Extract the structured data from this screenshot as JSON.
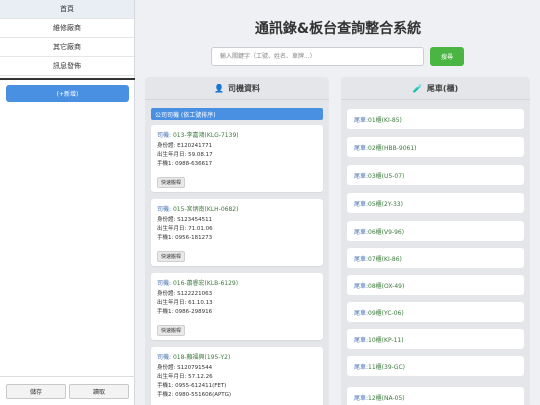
{
  "sidebar": {
    "nav": [
      "首頁",
      "維修廠商",
      "其它廠商",
      "訊息發佈"
    ],
    "add_label": "(+新增)",
    "save_label": "儲存",
    "load_label": "讀取"
  },
  "main": {
    "title": "通訊錄&板台查詢整合系統",
    "search_placeholder": "輸入關鍵字（工號、姓名、車牌...）",
    "search_button": "搜尋"
  },
  "drivers_panel": {
    "icon": "👤",
    "header": "司機資料",
    "group": "公司司機 (依工號排序)",
    "quick_label": "快速搬桿",
    "cards": [
      {
        "role": "司機: ",
        "name": "013-李嘉鴻(KLG-7139)",
        "lines": [
          "身份證: E120241771",
          "出生年月日: 59.08.17",
          "手機1: 0988-636617"
        ]
      },
      {
        "role": "司機: ",
        "name": "015-宮炳南(KLH-0682)",
        "lines": [
          "身份證: S123454511",
          "出生年月日: 71.01.06",
          "手機1: 0956-181273"
        ]
      },
      {
        "role": "司機: ",
        "name": "016-蕭睿宏(KLB-6129)",
        "lines": [
          "身份證: S122221063",
          "出生年月日: 61.10.13",
          "手機1: 0986-298916"
        ]
      },
      {
        "role": "司機: ",
        "name": "018-顏福興(195-Y2)",
        "lines": [
          "身份證: S120791544",
          "出生年月日: 57.12.26",
          "手機1: 0955-612411(FET)",
          "手機2: 0980-551606(APTG)"
        ]
      }
    ]
  },
  "tails_panel": {
    "icon": "🧪",
    "header": "尾車(櫃)",
    "prefix": "尾車: ",
    "items": [
      "01櫃(KI-85)",
      "02櫃(HBB-9061)",
      "03櫃(U5-07)",
      "05櫃(2Y-33)",
      "06櫃(V9-96)",
      "07櫃(KI-86)",
      "08櫃(OX-49)",
      "09櫃(YC-06)",
      "10櫃(KP-11)",
      "11櫃(39-GC)",
      "12櫃(NA-05)"
    ]
  },
  "colors": {
    "accent_blue": "#4a90e2",
    "search_green": "#4bb543",
    "link_green": "#3a7a3a"
  }
}
